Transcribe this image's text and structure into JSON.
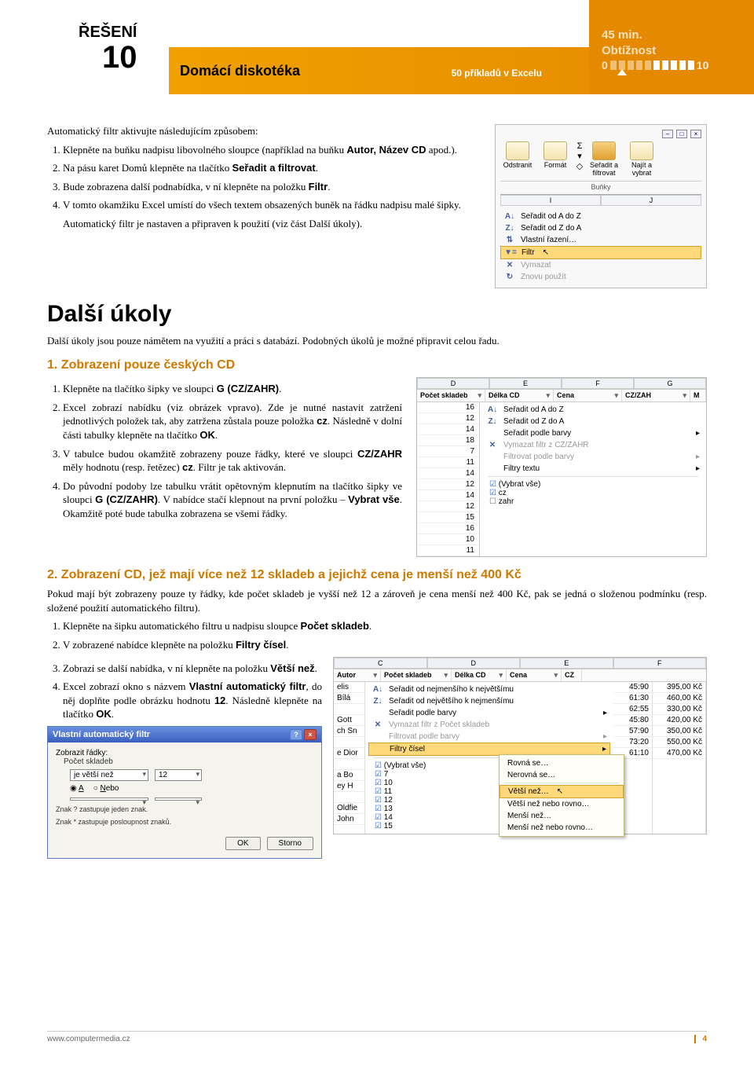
{
  "header": {
    "reseni": "ŘEŠENÍ",
    "number": "10",
    "subtitle": "Domácí diskotéka",
    "mid": "50 příkladů v Excelu",
    "time": "45 min.",
    "diff_label": "Obtížnost",
    "diff_min": "0",
    "diff_max": "10"
  },
  "intro": "Automatický filtr aktivujte následujícím způsobem:",
  "steps_a": [
    {
      "pre": "Klepněte na buňku nadpisu libovolného sloupce (například na buňku ",
      "b": "Autor, Název CD",
      "post": " apod.)."
    },
    {
      "pre": "Na pásu karet Domů klepněte na tlačítko ",
      "b": "Seřadit a filtrovat",
      "post": "."
    },
    {
      "pre": "Bude zobrazena další podnabídka, v ní klepněte na položku ",
      "b": "Filtr",
      "post": "."
    },
    {
      "pre": "V tomto okamžiku Excel umístí do všech textem obsazených buněk na řádku nadpisu malé šipky.",
      "b": "",
      "post": ""
    }
  ],
  "steps_a_tail": "Automatický filtr je nastaven a připraven k použití (viz část Další úkoly).",
  "h1": "Další úkoly",
  "para1": "Další úkoly jsou pouze námětem na využití a práci s databází. Podobných úkolů je možné připravit celou řadu.",
  "h2a": "1. Zobrazení pouze českých CD",
  "steps_b": [
    {
      "t": "Klepněte na tlačítko šipky ve sloupci ",
      "b": "G (CZ/ZAHR)",
      "post": "."
    },
    {
      "t": "Excel zobrazí nabídku (viz obrázek vpravo). Zde je nutné nastavit zatržení jednotlivých položek tak, aby zatržena zůstala pouze položka ",
      "b": "cz",
      "post": ". Následně v dolní části tabulky klepněte na tlačítko ",
      "b2": "OK",
      "post2": "."
    },
    {
      "t": "V tabulce budou okamžitě zobrazeny pouze řádky, které ve sloupci ",
      "b": "CZ/ZAHR",
      "post": " měly hodnotu (resp. řetězec) ",
      "b2": "cz",
      "post2": ". Filtr je tak aktivován."
    },
    {
      "t": "Do původní podoby lze tabulku vrátit opětovným klepnutím na tlačítko šipky ve sloupci ",
      "b": "G (CZ/ZAHR)",
      "post": ". V nabídce stačí klepnout na první položku – ",
      "b2": "Vybrat vše",
      "post2": ". Okamžitě poté bude tabulka zobrazena se všemi řádky."
    }
  ],
  "h2b": "2. Zobrazení CD, jež mají více než 12 skladeb a jejichž cena je menší než 400 Kč",
  "para2": "Pokud mají být zobrazeny pouze ty řádky, kde počet skladeb je vyšší než 12 a zároveň je cena menší než 400 Kč, pak se jedná o složenou podmínku (resp. složené použití automatického filtru).",
  "steps_c": [
    {
      "t": "Klepněte na šipku automatického filtru u nadpisu sloupce ",
      "b": "Počet skladeb",
      "post": "."
    },
    {
      "t": "V zobrazené nabídce klepněte na položku ",
      "b": "Filtry čísel",
      "post": "."
    },
    {
      "t": "Zobrazí se další nabídka, v ní klepněte na položku ",
      "b": "Větší než",
      "post": "."
    },
    {
      "t": "Excel zobrazí okno s názvem ",
      "b": "Vlastní automatický filtr",
      "post": ", do něj doplňte podle obrázku hodnotu ",
      "b2": "12",
      "post2": ". Následně klepněte na tlačítko ",
      "b3": "OK",
      "post3": "."
    }
  ],
  "shot1": {
    "btn1": "Odstranit",
    "btn2": "Formát",
    "btn3": "Seřadit a filtrovat",
    "btn4": "Najít a vybrat",
    "group": "Buňky",
    "cols": [
      "I",
      "J"
    ],
    "menu": [
      {
        "g": "A↓",
        "t": "Seřadit od A do Z"
      },
      {
        "g": "Z↓",
        "t": "Seřadit od Z do A"
      },
      {
        "g": "⇅",
        "t": "Vlastní řazení…"
      },
      {
        "g": "▼=",
        "t": "Filtr",
        "hl": true
      },
      {
        "g": "✕",
        "t": "Vymazat",
        "dim": true
      },
      {
        "g": "↻",
        "t": "Znovu použít",
        "dim": true
      }
    ]
  },
  "shot2": {
    "cols": [
      "D",
      "E",
      "F",
      "G"
    ],
    "head": [
      "Počet skladeb",
      "Délka CD",
      "Cena",
      "CZ/ZAH",
      "M"
    ],
    "vals": [
      16,
      12,
      14,
      18,
      7,
      11,
      14,
      12,
      14,
      12,
      15,
      16,
      10,
      11
    ],
    "menu": [
      {
        "g": "A↓",
        "t": "Seřadit od A do Z"
      },
      {
        "g": "Z↓",
        "t": "Seřadit od Z do A"
      },
      {
        "g": "",
        "t": "Seřadit podle barvy",
        "arrow": true
      },
      {
        "g": "✕",
        "t": "Vymazat filtr z CZ/ZAHR",
        "dim": true
      },
      {
        "g": "",
        "t": "Filtrovat podle barvy",
        "dim": true,
        "arrow": true
      },
      {
        "g": "",
        "t": "Filtry textu",
        "arrow": true
      }
    ],
    "checks": [
      {
        "t": "(Vybrat vše)",
        "c": true
      },
      {
        "t": "cz",
        "c": true
      },
      {
        "t": "zahr",
        "c": false
      }
    ]
  },
  "dialog": {
    "title": "Vlastní automatický filtr",
    "label1": "Zobrazit řádky:",
    "label2": "Počet skladeb",
    "op": "je větší než",
    "val": "12",
    "r1": "A",
    "r2": "Nebo",
    "note1": "Znak ? zastupuje jeden znak.",
    "note2": "Znak * zastupuje posloupnost znaků.",
    "ok": "OK",
    "cancel": "Storno"
  },
  "shot3": {
    "cols": [
      "C",
      "D",
      "E",
      "F"
    ],
    "head": [
      "Autor",
      "Počet skladeb",
      "Délka CD",
      "Cena",
      "CZ"
    ],
    "authors": [
      "elis",
      "Bílá",
      "",
      "Gott",
      "ch Sn",
      "",
      "e Dior",
      "",
      "a Bo",
      "ey H",
      "",
      "Oldfie",
      "John"
    ],
    "rows": [
      {
        "d": "45:90",
        "c": "395,00 Kč"
      },
      {
        "d": "61:30",
        "c": "460,00 Kč"
      },
      {
        "d": "62:55",
        "c": "330,00 Kč"
      },
      {
        "d": "45:80",
        "c": "420,00 Kč"
      },
      {
        "d": "57:90",
        "c": "350,00 Kč"
      },
      {
        "d": "73:20",
        "c": "550,00 Kč"
      },
      {
        "d": "61:10",
        "c": "470,00 Kč"
      }
    ],
    "menu": [
      {
        "g": "A↓",
        "t": "Seřadit od nejmenšího k největšímu"
      },
      {
        "g": "Z↓",
        "t": "Seřadit od největšího k nejmenšímu"
      },
      {
        "g": "",
        "t": "Seřadit podle barvy",
        "arrow": true
      },
      {
        "g": "✕",
        "t": "Vymazat filtr z Počet skladeb",
        "dim": true
      },
      {
        "g": "",
        "t": "Filtrovat podle barvy",
        "dim": true,
        "arrow": true
      },
      {
        "g": "",
        "t": "Filtry čísel",
        "arrow": true,
        "hl": true
      }
    ],
    "checks": [
      "(Vybrat vše)",
      "7",
      "10",
      "11",
      "12",
      "13",
      "14",
      "15"
    ],
    "submenu": [
      "Rovná se…",
      "Nerovná se…",
      "Větší než…",
      "Větší než nebo rovno…",
      "Menší než…",
      "Menší než nebo rovno…"
    ],
    "submenu_hl": 2
  },
  "footer": {
    "url": "www.computermedia.cz",
    "page": "4"
  }
}
